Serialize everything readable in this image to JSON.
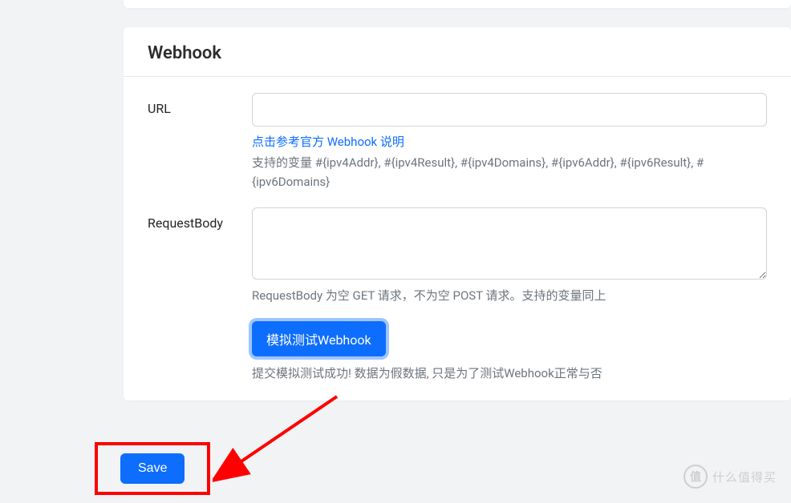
{
  "card": {
    "title": "Webhook"
  },
  "url": {
    "label": "URL",
    "value": "",
    "link_text": "点击参考官方 Webhook 说明",
    "help_text": "支持的变量 #{ipv4Addr}, #{ipv4Result}, #{ipv4Domains}, #{ipv6Addr}, #{ipv6Result}, #{ipv6Domains}"
  },
  "request_body": {
    "label": "RequestBody",
    "value": "",
    "help_text": "RequestBody 为空 GET 请求，不为空 POST 请求。支持的变量同上"
  },
  "test": {
    "button_label": "模拟测试Webhook",
    "status_text": "提交模拟测试成功! 数据为假数据, 只是为了测试Webhook正常与否"
  },
  "save": {
    "button_label": "Save"
  },
  "watermark": {
    "icon": "值",
    "text": "什么值得买"
  }
}
